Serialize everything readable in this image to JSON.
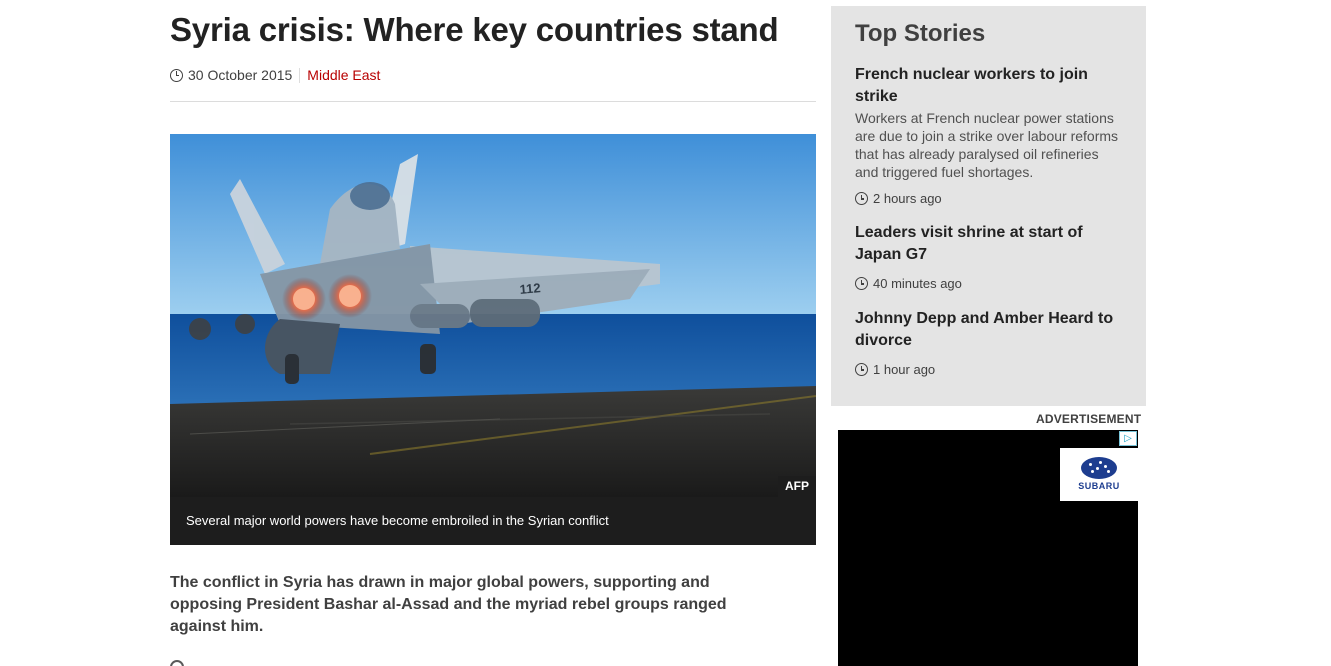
{
  "article": {
    "headline": "Syria crisis: Where key countries stand",
    "date": "30 October 2015",
    "section": "Middle East",
    "image_credit": "AFP",
    "image_caption": "Several major world powers have become embroiled in the Syrian conflict",
    "intro": "The conflict in Syria has drawn in major global powers, supporting and opposing President Bashar al-Assad and the myriad rebel groups ranged against him.",
    "jet_number": "112"
  },
  "sidebar": {
    "title": "Top Stories",
    "stories": [
      {
        "title": "French nuclear workers to join strike",
        "summary": "Workers at French nuclear power stations are due to join a strike over labour reforms that has already paralysed oil refineries and triggered fuel shortages.",
        "time": "2 hours ago"
      },
      {
        "title": "Leaders visit shrine at start of Japan G7",
        "time": "40 minutes ago"
      },
      {
        "title": "Johnny Depp and Amber Heard to divorce",
        "time": "1 hour ago"
      }
    ]
  },
  "ad": {
    "label": "ADVERTISEMENT",
    "brand": "SUBARU",
    "adchoices_icon": "adchoices-icon"
  },
  "colors": {
    "section_link": "#b80000",
    "sidebar_bg": "#e4e4e4",
    "caption_bg": "#1d1d1d"
  }
}
